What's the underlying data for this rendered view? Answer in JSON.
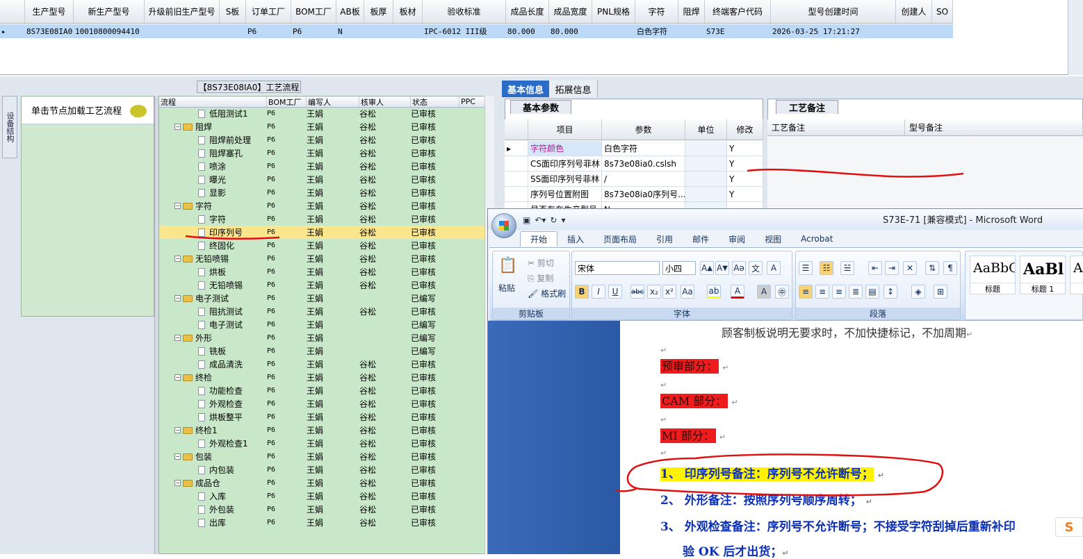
{
  "top_grid": {
    "columns": [
      "",
      "生产型号",
      "新生产型号",
      "升级前旧生产型号",
      "S板",
      "订单工厂",
      "BOM工厂",
      "AB板",
      "板厚",
      "板材",
      "验收标准",
      "成品长度",
      "成品宽度",
      "PNL规格",
      "字符",
      "阻焊",
      "终端客户代码",
      "型号创建时间",
      "创建人",
      "SO"
    ],
    "row": [
      "▸",
      "8S73E08IA0",
      "10010800094410",
      "",
      "",
      "P6",
      "P6",
      "N",
      "",
      "",
      "IPC-6012 III级",
      "80.000",
      "80.000",
      "",
      "白色字符",
      "",
      "S73E",
      "2026-03-25 17:21:27",
      "",
      ""
    ]
  },
  "process_panel": {
    "title": "【8S73E08IA0】工艺流程",
    "vertical_tab": "设备结构",
    "load_hint": "单击节点加载工艺流程"
  },
  "tree": {
    "columns": [
      "流程",
      "BOM工厂",
      "编写人",
      "核审人",
      "状态",
      "PPC"
    ],
    "rows": [
      {
        "level": 2,
        "name": "低阻测试1",
        "bom": "P6",
        "editor": "王娟",
        "reviewer": "谷松",
        "status": "已审核"
      },
      {
        "level": 1,
        "name": "阻焊",
        "bom": "P6",
        "editor": "王娟",
        "reviewer": "谷松",
        "status": "已审核"
      },
      {
        "level": 2,
        "name": "阻焊前处理",
        "bom": "P6",
        "editor": "王娟",
        "reviewer": "谷松",
        "status": "已审核"
      },
      {
        "level": 2,
        "name": "阻焊塞孔",
        "bom": "P6",
        "editor": "王娟",
        "reviewer": "谷松",
        "status": "已审核"
      },
      {
        "level": 2,
        "name": "喷涂",
        "bom": "P6",
        "editor": "王娟",
        "reviewer": "谷松",
        "status": "已审核"
      },
      {
        "level": 2,
        "name": "曝光",
        "bom": "P6",
        "editor": "王娟",
        "reviewer": "谷松",
        "status": "已审核"
      },
      {
        "level": 2,
        "name": "显影",
        "bom": "P6",
        "editor": "王娟",
        "reviewer": "谷松",
        "status": "已审核"
      },
      {
        "level": 1,
        "name": "字符",
        "bom": "P6",
        "editor": "王娟",
        "reviewer": "谷松",
        "status": "已审核"
      },
      {
        "level": 2,
        "name": "字符",
        "bom": "P6",
        "editor": "王娟",
        "reviewer": "谷松",
        "status": "已审核"
      },
      {
        "level": 2,
        "name": "印序列号",
        "bom": "P6",
        "editor": "王娟",
        "reviewer": "谷松",
        "status": "已审核",
        "selected": true
      },
      {
        "level": 2,
        "name": "终固化",
        "bom": "P6",
        "editor": "王娟",
        "reviewer": "谷松",
        "status": "已审核"
      },
      {
        "level": 1,
        "name": "无铅喷锡",
        "bom": "P6",
        "editor": "王娟",
        "reviewer": "谷松",
        "status": "已审核"
      },
      {
        "level": 2,
        "name": "烘板",
        "bom": "P6",
        "editor": "王娟",
        "reviewer": "谷松",
        "status": "已审核"
      },
      {
        "level": 2,
        "name": "无铅喷锡",
        "bom": "P6",
        "editor": "王娟",
        "reviewer": "谷松",
        "status": "已审核"
      },
      {
        "level": 1,
        "name": "电子测试",
        "bom": "P6",
        "editor": "王娟",
        "reviewer": "",
        "status": "已编写"
      },
      {
        "level": 2,
        "name": "阻抗测试",
        "bom": "P6",
        "editor": "王娟",
        "reviewer": "谷松",
        "status": "已审核"
      },
      {
        "level": 2,
        "name": "电子测试",
        "bom": "P6",
        "editor": "王娟",
        "reviewer": "",
        "status": "已编写"
      },
      {
        "level": 1,
        "name": "外形",
        "bom": "P6",
        "editor": "王娟",
        "reviewer": "",
        "status": "已编写"
      },
      {
        "level": 2,
        "name": "铣板",
        "bom": "P6",
        "editor": "王娟",
        "reviewer": "",
        "status": "已编写"
      },
      {
        "level": 2,
        "name": "成品清洗",
        "bom": "P6",
        "editor": "王娟",
        "reviewer": "谷松",
        "status": "已审核"
      },
      {
        "level": 1,
        "name": "终检",
        "bom": "P6",
        "editor": "王娟",
        "reviewer": "谷松",
        "status": "已审核"
      },
      {
        "level": 2,
        "name": "功能检查",
        "bom": "P6",
        "editor": "王娟",
        "reviewer": "谷松",
        "status": "已审核"
      },
      {
        "level": 2,
        "name": "外观检查",
        "bom": "P6",
        "editor": "王娟",
        "reviewer": "谷松",
        "status": "已审核"
      },
      {
        "level": 2,
        "name": "烘板整平",
        "bom": "P6",
        "editor": "王娟",
        "reviewer": "谷松",
        "status": "已审核"
      },
      {
        "level": 1,
        "name": "终检1",
        "bom": "P6",
        "editor": "王娟",
        "reviewer": "谷松",
        "status": "已审核"
      },
      {
        "level": 2,
        "name": "外观检查1",
        "bom": "P6",
        "editor": "王娟",
        "reviewer": "谷松",
        "status": "已审核"
      },
      {
        "level": 1,
        "name": "包装",
        "bom": "P6",
        "editor": "王娟",
        "reviewer": "谷松",
        "status": "已审核"
      },
      {
        "level": 2,
        "name": "内包装",
        "bom": "P6",
        "editor": "王娟",
        "reviewer": "谷松",
        "status": "已审核"
      },
      {
        "level": 1,
        "name": "成品仓",
        "bom": "P6",
        "editor": "王娟",
        "reviewer": "谷松",
        "status": "已审核"
      },
      {
        "level": 2,
        "name": "入库",
        "bom": "P6",
        "editor": "王娟",
        "reviewer": "谷松",
        "status": "已审核"
      },
      {
        "level": 2,
        "name": "外包装",
        "bom": "P6",
        "editor": "王娟",
        "reviewer": "谷松",
        "status": "已审核"
      },
      {
        "level": 2,
        "name": "出库",
        "bom": "P6",
        "editor": "王娟",
        "reviewer": "谷松",
        "status": "已审核"
      }
    ]
  },
  "right_tabs": {
    "basic": "基本信息",
    "extended": "拓展信息"
  },
  "basic_params": {
    "tab": "基本参数",
    "columns": [
      "",
      "项目",
      "参数",
      "单位",
      "修改"
    ],
    "rows": [
      {
        "marker": "▸",
        "item": "字符颜色",
        "value": "白色字符",
        "unit": "",
        "edit": "Y",
        "item_color": "#c0109a"
      },
      {
        "marker": "",
        "item": "CS面印序列号菲林",
        "value": "8s73e08ia0.cslsh",
        "unit": "",
        "edit": "Y"
      },
      {
        "marker": "",
        "item": "SS面印序列号菲林",
        "value": "/",
        "unit": "",
        "edit": "Y"
      },
      {
        "marker": "",
        "item": "序列号位置附图",
        "value": "8s73e08ia0序列号...",
        "unit": "",
        "edit": "Y"
      },
      {
        "marker": "",
        "item": "是否有在生产型号",
        "value": "N",
        "unit": "",
        "edit": ""
      }
    ]
  },
  "notes": {
    "tab": "工艺备注",
    "col1": "工艺备注",
    "col2": "型号备注"
  },
  "word": {
    "title": "S73E-71 [兼容模式] - Microsoft Word",
    "tabs": [
      "开始",
      "插入",
      "页面布局",
      "引用",
      "邮件",
      "审阅",
      "视图",
      "Acrobat"
    ],
    "clipboard": {
      "paste": "粘贴",
      "cut": "剪切",
      "copy": "复制",
      "format_painter": "格式刷",
      "group": "剪贴板"
    },
    "font": {
      "family": "宋体",
      "size": "小四",
      "group": "字体"
    },
    "paragraph_group": "段落",
    "styles": [
      {
        "sample": "AaBbC",
        "label": "标题"
      },
      {
        "sample": "AaBl",
        "label": "标题 1"
      },
      {
        "sample": "A",
        "label": ""
      }
    ],
    "doc_lines": {
      "top": "顾客制板说明无要求时，不加快捷标记，不加周期",
      "pre_review": "预审部分：",
      "cam": "CAM 部分：",
      "mi": "MI 部分：",
      "item1": "1、 印序列号备注：序列号不允许断号；",
      "item2": "2、 外形备注：按照序列号顺序周转；",
      "item3": "3、 外观检查备注：序列号不允许断号；不接受字符刮掉后重新补印",
      "item3b": "验 OK 后才出货；"
    },
    "ime_badge": "S"
  },
  "colors": {
    "selection_blue": "#bcd9f7",
    "tree_green": "#c9e8c9",
    "selected_row": "#fbe58d",
    "annotation_red": "#e01010",
    "tab_blue": "#2a6cc7"
  }
}
